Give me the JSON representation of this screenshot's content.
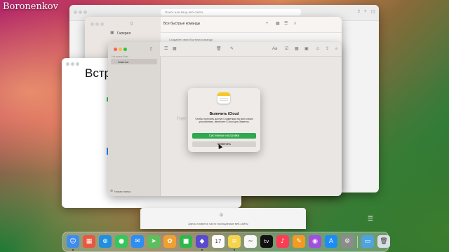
{
  "watermark": "Boronenkov",
  "safari": {
    "address_placeholder": "Поиск или ввод веб-сайта",
    "newtab_text": "Здесь появятся часто посещаемые веб-сайты"
  },
  "shortcuts": {
    "sidebar_item": "Галерея",
    "title": "Все быстрые команды",
    "tile_text": "Создайте свою быструю команду"
  },
  "textedit": {
    "visible_text": "Встр"
  },
  "notes": {
    "sidebar_header": "На моем Mac",
    "sidebar_item": "Заметки",
    "new_folder": "Новая папка",
    "empty_text": "Нет"
  },
  "dialog": {
    "title": "Включить iCloud",
    "message": "Чтобы получить доступ к заметкам на всех своих устройствах, включите iCloud для Заметок.",
    "primary_button": "Системные настройки",
    "cancel_button": "Отменить"
  },
  "dock": {
    "apps": [
      {
        "name": "finder",
        "glyph": "☺",
        "color": "#3f8cf0"
      },
      {
        "name": "launchpad",
        "glyph": "▦",
        "color": "#e9573f"
      },
      {
        "name": "safari",
        "glyph": "⊕",
        "color": "#1f8fe0"
      },
      {
        "name": "messages",
        "glyph": "●",
        "color": "#34c759"
      },
      {
        "name": "mail",
        "glyph": "✉",
        "color": "#2c8df4"
      },
      {
        "name": "maps",
        "glyph": "➤",
        "color": "#5bbf5b"
      },
      {
        "name": "photos",
        "glyph": "✿",
        "color": "#f0a030"
      },
      {
        "name": "facetime",
        "glyph": "■",
        "color": "#2fb84a"
      },
      {
        "name": "shortcuts",
        "glyph": "◆",
        "color": "#5a4ad0"
      },
      {
        "name": "calendar",
        "glyph": "17",
        "color": "#ffffff"
      },
      {
        "name": "notes",
        "glyph": "≡",
        "color": "#f5d34a"
      },
      {
        "name": "freeform",
        "glyph": "~",
        "color": "#f7f7f7"
      },
      {
        "name": "appletv",
        "glyph": "tv",
        "color": "#111111"
      },
      {
        "name": "music",
        "glyph": "♪",
        "color": "#fa3d55"
      },
      {
        "name": "pages",
        "glyph": "✎",
        "color": "#f29a24"
      },
      {
        "name": "podcasts",
        "glyph": "◉",
        "color": "#a14fe0"
      },
      {
        "name": "appstore",
        "glyph": "A",
        "color": "#1c8cf7"
      },
      {
        "name": "settings",
        "glyph": "⚙",
        "color": "#8c8c8c"
      },
      {
        "name": "downloads",
        "glyph": "▭",
        "color": "#4fa3e0"
      },
      {
        "name": "trash",
        "glyph": "🗑",
        "color": "#d9dfe4"
      }
    ]
  }
}
